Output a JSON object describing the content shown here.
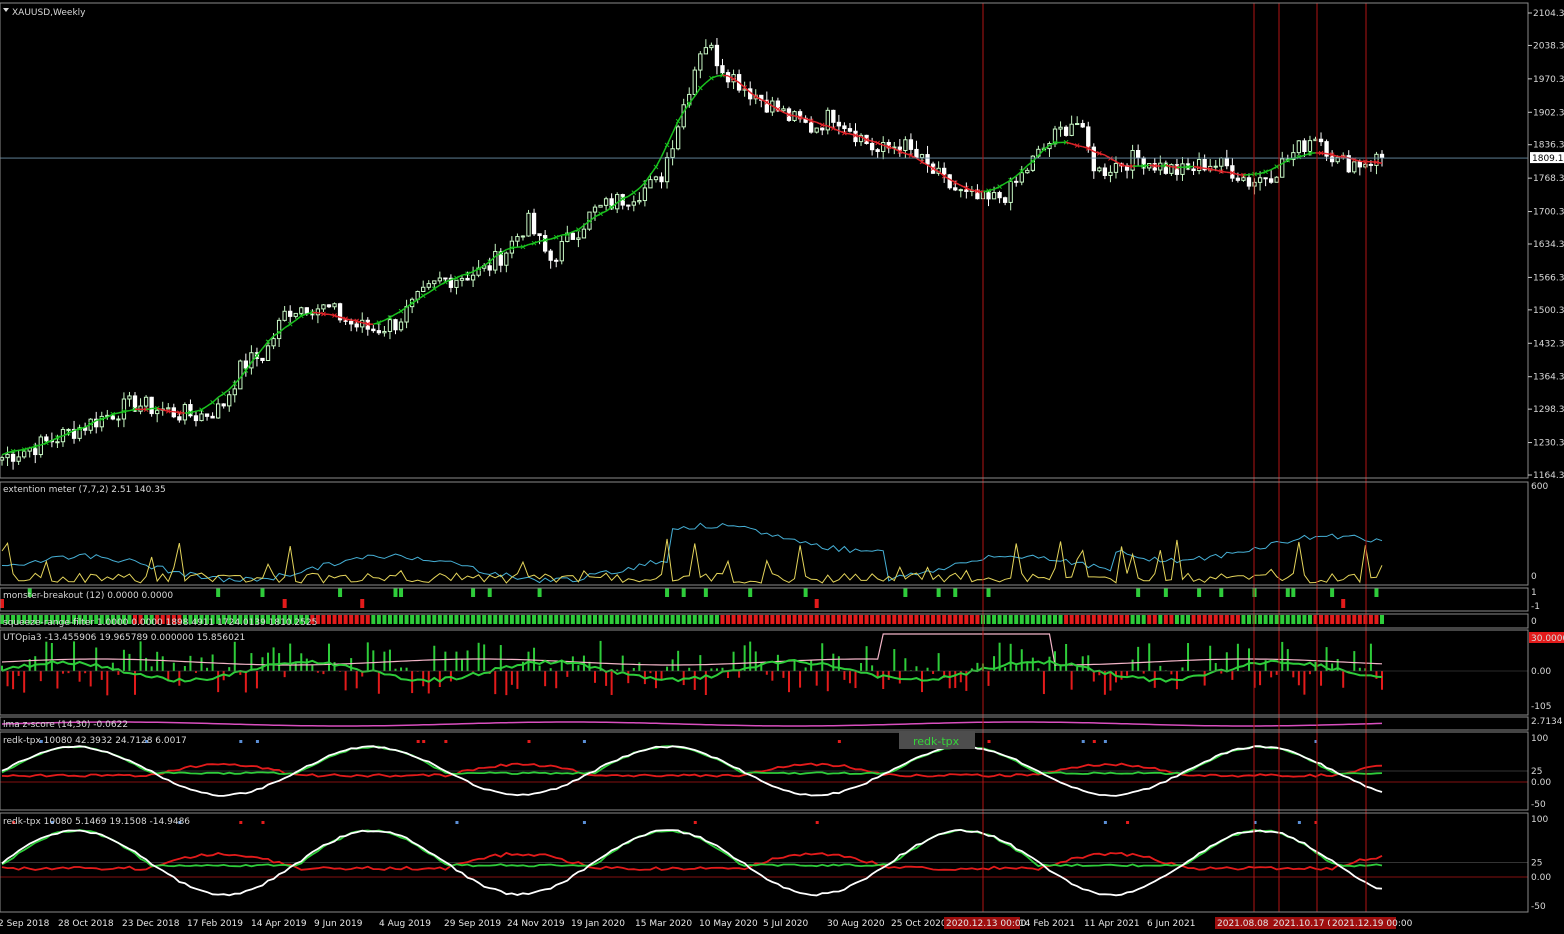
{
  "colors": {
    "background": "#000000",
    "bull_candle": "#c8f7c5",
    "bear_candle": "#ffffff",
    "trail_up": "#19c21e",
    "trail_down": "#e0242a",
    "grid_red": "#b01515",
    "cyan_line": "#46b0d6",
    "yellow_line": "#e4d45b",
    "pink_line": "#f4b5c8",
    "green": "#2ecc3a",
    "red": "#e31b1b",
    "white": "#ffffff"
  },
  "main_panel": {
    "title": "XAUUSD,Weekly",
    "current_price": "1809.12",
    "price_levels": [
      "2104.30",
      "2038.30",
      "1970.30",
      "1902.30",
      "1836.30",
      "1768.30",
      "1700.30",
      "1634.30",
      "1566.30",
      "1500.30",
      "1432.30",
      "1364.30",
      "1298.30",
      "1230.30",
      "1164.30"
    ]
  },
  "indicators": {
    "extention": {
      "label": "extention meter (7,7,2) 2.51 140.35",
      "scale_top": "600",
      "scale_bottom": "0"
    },
    "monster": {
      "label": "monster-breakout (12) 0.0000 0.0000",
      "scale_top": "1",
      "scale_bottom": "-1"
    },
    "squeeze": {
      "label": "squeeze-range-filter 1.0000 0.0000 1898.4911 1724.0139 1810.2525",
      "scale": "0"
    },
    "utopia": {
      "label": "UTOpia3 -13.455906 19.965789 0.000000 15.856021",
      "scale_top": "30.0000",
      "scale_mid": "0.00",
      "scale_bottom": "-105"
    },
    "lma": {
      "label": "lma z-score (14,30) -0.0622",
      "scale_top": "2.7134"
    },
    "redk1": {
      "label": "redk-tpx 10080 42.3932 24.7128 6.0017",
      "scale": [
        "100",
        "25",
        "0.00",
        "-50"
      ],
      "tag": "redk-tpx"
    },
    "redk2": {
      "label": "redk-tpx 10080 5.1469 19.1508 -14.9486",
      "scale": [
        "100",
        "25",
        "0.00",
        "-50"
      ]
    }
  },
  "dates": [
    "2 Sep 2018",
    "28 Oct 2018",
    "23 Dec 2018",
    "17 Feb 2019",
    "14 Apr 2019",
    "9 Jun 2019",
    "4 Aug 2019",
    "29 Sep 2019",
    "24 Nov 2019",
    "19 Jan 2020",
    "15 Mar 2020",
    "10 May 2020",
    "5 Jul 2020",
    "30 Aug 2020",
    "25 Oct 2020",
    "14 Feb 2021",
    "11 Apr 2021",
    "6 Jun 2021"
  ],
  "date_markers": [
    "2020.12.13 00:00",
    "2021.08.08 00:00",
    "2021.10.17 00:00",
    "2021.12.19 00:00"
  ],
  "chart_data": {
    "type": "candlestick",
    "title": "XAUUSD,Weekly",
    "series": [
      {
        "name": "XAUUSD",
        "anchor_closes": [
          1200,
          1215,
          1230,
          1250,
          1270,
          1290,
          1310,
          1300,
          1290,
          1285,
          1300,
          1390,
          1410,
          1500,
          1510,
          1500,
          1470,
          1460,
          1475,
          1520,
          1560,
          1570,
          1580,
          1620,
          1680,
          1600,
          1650,
          1700,
          1720,
          1740,
          1760,
          1900,
          2050,
          1990,
          1950,
          1920,
          1890,
          1870,
          1900,
          1860,
          1820,
          1840,
          1800,
          1760,
          1730,
          1720,
          1740,
          1800,
          1850,
          1890,
          1780,
          1800,
          1810,
          1790,
          1780,
          1800,
          1790,
          1760,
          1780,
          1820,
          1860,
          1800,
          1800,
          1810
        ],
        "ylim": [
          1164.3,
          2104.3
        ]
      }
    ]
  }
}
